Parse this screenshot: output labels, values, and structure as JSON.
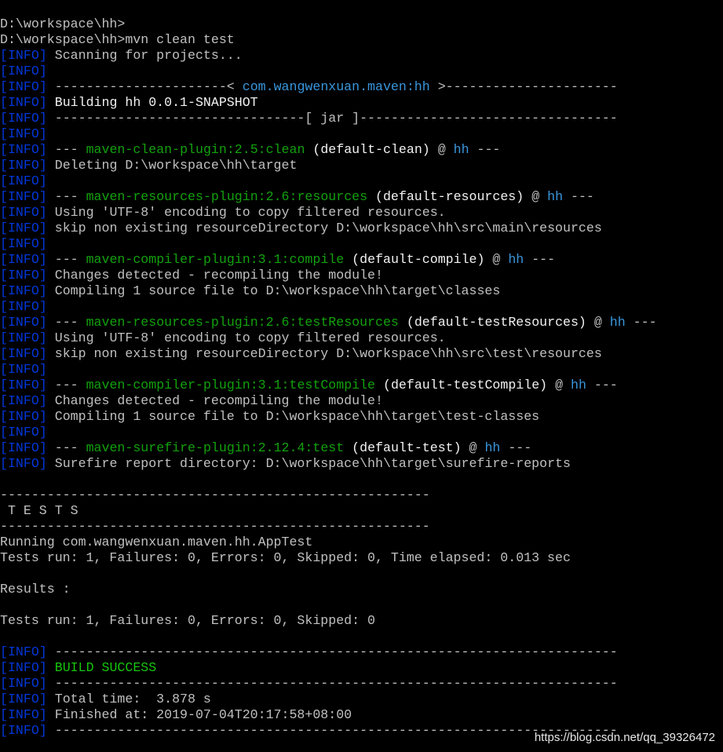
{
  "terminal": {
    "lines": [
      [
        {
          "t": "D:\\workspace\\hh>",
          "c": "gray"
        }
      ],
      [
        {
          "t": "D:\\workspace\\hh>mvn clean test",
          "c": "gray"
        }
      ],
      [
        {
          "t": "[",
          "c": "blue"
        },
        {
          "t": "INFO",
          "c": "blue"
        },
        {
          "t": "] ",
          "c": "blue"
        },
        {
          "t": "Scanning for projects...",
          "c": "gray"
        }
      ],
      [
        {
          "t": "[",
          "c": "blue"
        },
        {
          "t": "INFO",
          "c": "blue"
        },
        {
          "t": "]",
          "c": "blue"
        }
      ],
      [
        {
          "t": "[",
          "c": "blue"
        },
        {
          "t": "INFO",
          "c": "blue"
        },
        {
          "t": "] ",
          "c": "blue"
        },
        {
          "t": "----------------------< ",
          "c": "gray"
        },
        {
          "t": "com.wangwenxuan.maven:hh",
          "c": "teal"
        },
        {
          "t": " >----------------------",
          "c": "gray"
        }
      ],
      [
        {
          "t": "[",
          "c": "blue"
        },
        {
          "t": "INFO",
          "c": "blue"
        },
        {
          "t": "] ",
          "c": "blue"
        },
        {
          "t": "Building hh 0.0.1-SNAPSHOT",
          "c": "white"
        }
      ],
      [
        {
          "t": "[",
          "c": "blue"
        },
        {
          "t": "INFO",
          "c": "blue"
        },
        {
          "t": "] ",
          "c": "blue"
        },
        {
          "t": "--------------------------------[ jar ]---------------------------------",
          "c": "gray"
        }
      ],
      [
        {
          "t": "[",
          "c": "blue"
        },
        {
          "t": "INFO",
          "c": "blue"
        },
        {
          "t": "]",
          "c": "blue"
        }
      ],
      [
        {
          "t": "[",
          "c": "blue"
        },
        {
          "t": "INFO",
          "c": "blue"
        },
        {
          "t": "] ",
          "c": "blue"
        },
        {
          "t": "--- ",
          "c": "gray"
        },
        {
          "t": "maven-clean-plugin:2.5:clean",
          "c": "green"
        },
        {
          "t": " (default-clean)",
          "c": "white"
        },
        {
          "t": " @ ",
          "c": "gray"
        },
        {
          "t": "hh",
          "c": "teal"
        },
        {
          "t": " ---",
          "c": "gray"
        }
      ],
      [
        {
          "t": "[",
          "c": "blue"
        },
        {
          "t": "INFO",
          "c": "blue"
        },
        {
          "t": "] ",
          "c": "blue"
        },
        {
          "t": "Deleting D:\\workspace\\hh\\target",
          "c": "gray"
        }
      ],
      [
        {
          "t": "[",
          "c": "blue"
        },
        {
          "t": "INFO",
          "c": "blue"
        },
        {
          "t": "]",
          "c": "blue"
        }
      ],
      [
        {
          "t": "[",
          "c": "blue"
        },
        {
          "t": "INFO",
          "c": "blue"
        },
        {
          "t": "] ",
          "c": "blue"
        },
        {
          "t": "--- ",
          "c": "gray"
        },
        {
          "t": "maven-resources-plugin:2.6:resources",
          "c": "green"
        },
        {
          "t": " (default-resources)",
          "c": "white"
        },
        {
          "t": " @ ",
          "c": "gray"
        },
        {
          "t": "hh",
          "c": "teal"
        },
        {
          "t": " ---",
          "c": "gray"
        }
      ],
      [
        {
          "t": "[",
          "c": "blue"
        },
        {
          "t": "INFO",
          "c": "blue"
        },
        {
          "t": "] ",
          "c": "blue"
        },
        {
          "t": "Using 'UTF-8' encoding to copy filtered resources.",
          "c": "gray"
        }
      ],
      [
        {
          "t": "[",
          "c": "blue"
        },
        {
          "t": "INFO",
          "c": "blue"
        },
        {
          "t": "] ",
          "c": "blue"
        },
        {
          "t": "skip non existing resourceDirectory D:\\workspace\\hh\\src\\main\\resources",
          "c": "gray"
        }
      ],
      [
        {
          "t": "[",
          "c": "blue"
        },
        {
          "t": "INFO",
          "c": "blue"
        },
        {
          "t": "]",
          "c": "blue"
        }
      ],
      [
        {
          "t": "[",
          "c": "blue"
        },
        {
          "t": "INFO",
          "c": "blue"
        },
        {
          "t": "] ",
          "c": "blue"
        },
        {
          "t": "--- ",
          "c": "gray"
        },
        {
          "t": "maven-compiler-plugin:3.1:compile",
          "c": "green"
        },
        {
          "t": " (default-compile)",
          "c": "white"
        },
        {
          "t": " @ ",
          "c": "gray"
        },
        {
          "t": "hh",
          "c": "teal"
        },
        {
          "t": " ---",
          "c": "gray"
        }
      ],
      [
        {
          "t": "[",
          "c": "blue"
        },
        {
          "t": "INFO",
          "c": "blue"
        },
        {
          "t": "] ",
          "c": "blue"
        },
        {
          "t": "Changes detected - recompiling the module!",
          "c": "gray"
        }
      ],
      [
        {
          "t": "[",
          "c": "blue"
        },
        {
          "t": "INFO",
          "c": "blue"
        },
        {
          "t": "] ",
          "c": "blue"
        },
        {
          "t": "Compiling 1 source file to D:\\workspace\\hh\\target\\classes",
          "c": "gray"
        }
      ],
      [
        {
          "t": "[",
          "c": "blue"
        },
        {
          "t": "INFO",
          "c": "blue"
        },
        {
          "t": "]",
          "c": "blue"
        }
      ],
      [
        {
          "t": "[",
          "c": "blue"
        },
        {
          "t": "INFO",
          "c": "blue"
        },
        {
          "t": "] ",
          "c": "blue"
        },
        {
          "t": "--- ",
          "c": "gray"
        },
        {
          "t": "maven-resources-plugin:2.6:testResources",
          "c": "green"
        },
        {
          "t": " (default-testResources)",
          "c": "white"
        },
        {
          "t": " @ ",
          "c": "gray"
        },
        {
          "t": "hh",
          "c": "teal"
        },
        {
          "t": " ---",
          "c": "gray"
        }
      ],
      [
        {
          "t": "[",
          "c": "blue"
        },
        {
          "t": "INFO",
          "c": "blue"
        },
        {
          "t": "] ",
          "c": "blue"
        },
        {
          "t": "Using 'UTF-8' encoding to copy filtered resources.",
          "c": "gray"
        }
      ],
      [
        {
          "t": "[",
          "c": "blue"
        },
        {
          "t": "INFO",
          "c": "blue"
        },
        {
          "t": "] ",
          "c": "blue"
        },
        {
          "t": "skip non existing resourceDirectory D:\\workspace\\hh\\src\\test\\resources",
          "c": "gray"
        }
      ],
      [
        {
          "t": "[",
          "c": "blue"
        },
        {
          "t": "INFO",
          "c": "blue"
        },
        {
          "t": "]",
          "c": "blue"
        }
      ],
      [
        {
          "t": "[",
          "c": "blue"
        },
        {
          "t": "INFO",
          "c": "blue"
        },
        {
          "t": "] ",
          "c": "blue"
        },
        {
          "t": "--- ",
          "c": "gray"
        },
        {
          "t": "maven-compiler-plugin:3.1:testCompile",
          "c": "green"
        },
        {
          "t": " (default-testCompile)",
          "c": "white"
        },
        {
          "t": " @ ",
          "c": "gray"
        },
        {
          "t": "hh",
          "c": "teal"
        },
        {
          "t": " ---",
          "c": "gray"
        }
      ],
      [
        {
          "t": "[",
          "c": "blue"
        },
        {
          "t": "INFO",
          "c": "blue"
        },
        {
          "t": "] ",
          "c": "blue"
        },
        {
          "t": "Changes detected - recompiling the module!",
          "c": "gray"
        }
      ],
      [
        {
          "t": "[",
          "c": "blue"
        },
        {
          "t": "INFO",
          "c": "blue"
        },
        {
          "t": "] ",
          "c": "blue"
        },
        {
          "t": "Compiling 1 source file to D:\\workspace\\hh\\target\\test-classes",
          "c": "gray"
        }
      ],
      [
        {
          "t": "[",
          "c": "blue"
        },
        {
          "t": "INFO",
          "c": "blue"
        },
        {
          "t": "]",
          "c": "blue"
        }
      ],
      [
        {
          "t": "[",
          "c": "blue"
        },
        {
          "t": "INFO",
          "c": "blue"
        },
        {
          "t": "] ",
          "c": "blue"
        },
        {
          "t": "--- ",
          "c": "gray"
        },
        {
          "t": "maven-surefire-plugin:2.12.4:test",
          "c": "green"
        },
        {
          "t": " (default-test)",
          "c": "white"
        },
        {
          "t": " @ ",
          "c": "gray"
        },
        {
          "t": "hh",
          "c": "teal"
        },
        {
          "t": " ---",
          "c": "gray"
        }
      ],
      [
        {
          "t": "[",
          "c": "blue"
        },
        {
          "t": "INFO",
          "c": "blue"
        },
        {
          "t": "] ",
          "c": "blue"
        },
        {
          "t": "Surefire report directory: D:\\workspace\\hh\\target\\surefire-reports",
          "c": "gray"
        }
      ],
      [
        {
          "t": "",
          "c": "gray"
        }
      ],
      [
        {
          "t": "-------------------------------------------------------",
          "c": "gray"
        }
      ],
      [
        {
          "t": " T E S T S",
          "c": "gray"
        }
      ],
      [
        {
          "t": "-------------------------------------------------------",
          "c": "gray"
        }
      ],
      [
        {
          "t": "Running com.wangwenxuan.maven.hh.AppTest",
          "c": "gray"
        }
      ],
      [
        {
          "t": "Tests run: 1, Failures: 0, Errors: 0, Skipped: 0, Time elapsed: 0.013 sec",
          "c": "gray"
        }
      ],
      [
        {
          "t": "",
          "c": "gray"
        }
      ],
      [
        {
          "t": "Results :",
          "c": "gray"
        }
      ],
      [
        {
          "t": "",
          "c": "gray"
        }
      ],
      [
        {
          "t": "Tests run: 1, Failures: 0, Errors: 0, Skipped: 0",
          "c": "gray"
        }
      ],
      [
        {
          "t": "",
          "c": "gray"
        }
      ],
      [
        {
          "t": "[",
          "c": "blue"
        },
        {
          "t": "INFO",
          "c": "blue"
        },
        {
          "t": "] ",
          "c": "blue"
        },
        {
          "t": "------------------------------------------------------------------------",
          "c": "gray"
        }
      ],
      [
        {
          "t": "[",
          "c": "blue"
        },
        {
          "t": "INFO",
          "c": "blue"
        },
        {
          "t": "] ",
          "c": "blue"
        },
        {
          "t": "BUILD SUCCESS",
          "c": "lgreen"
        }
      ],
      [
        {
          "t": "[",
          "c": "blue"
        },
        {
          "t": "INFO",
          "c": "blue"
        },
        {
          "t": "] ",
          "c": "blue"
        },
        {
          "t": "------------------------------------------------------------------------",
          "c": "gray"
        }
      ],
      [
        {
          "t": "[",
          "c": "blue"
        },
        {
          "t": "INFO",
          "c": "blue"
        },
        {
          "t": "] ",
          "c": "blue"
        },
        {
          "t": "Total time:  3.878 s",
          "c": "gray"
        }
      ],
      [
        {
          "t": "[",
          "c": "blue"
        },
        {
          "t": "INFO",
          "c": "blue"
        },
        {
          "t": "] ",
          "c": "blue"
        },
        {
          "t": "Finished at: 2019-07-04T20:17:58+08:00",
          "c": "gray"
        }
      ],
      [
        {
          "t": "[",
          "c": "blue"
        },
        {
          "t": "INFO",
          "c": "blue"
        },
        {
          "t": "] ",
          "c": "blue"
        },
        {
          "t": "------------------------------------------------------------------------",
          "c": "gray"
        }
      ]
    ]
  },
  "watermark": "https://blog.csdn.net/qq_39326472",
  "colors": {
    "background": "#000000",
    "text": "#c0c0c0",
    "bright_text": "#f2f2f2",
    "info_tag": "#0037da",
    "artifact": "#3a96dd",
    "plugin": "#13a10e",
    "success": "#16c60c"
  }
}
